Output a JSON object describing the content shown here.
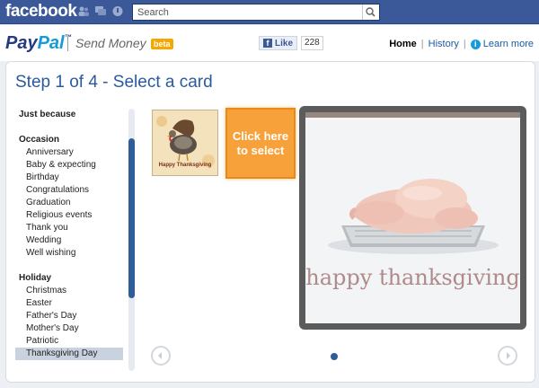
{
  "facebook": {
    "logo": "facebook",
    "search_placeholder": "Search",
    "icons": [
      "friends-icon",
      "messages-icon",
      "notifications-icon"
    ],
    "brand_color": "#3b5998"
  },
  "paypal": {
    "logo_pay": "Pay",
    "logo_pal": "Pal",
    "logo_tm": "™",
    "app_name": "Send Money",
    "beta_badge": "beta",
    "like_label": "Like",
    "like_count": "228",
    "nav": {
      "home": "Home",
      "history": "History",
      "separator": "|",
      "learn_more": "Learn more"
    }
  },
  "step_title": "Step 1 of 4 - Select a card",
  "categories": {
    "just_because": "Just because",
    "occasion_heading": "Occasion",
    "occasion_items": [
      "Anniversary",
      "Baby & expecting",
      "Birthday",
      "Congratulations",
      "Graduation",
      "Religious events",
      "Thank you",
      "Wedding",
      "Well wishing"
    ],
    "holiday_heading": "Holiday",
    "holiday_items": [
      "Christmas",
      "Easter",
      "Father's Day",
      "Mother's Day",
      "Patriotic",
      "Thanksgiving Day"
    ],
    "selected": "Thanksgiving Day"
  },
  "cards": {
    "thumb1_caption": "Happy Thanksgiving",
    "select_prompt_line1": "Click here",
    "select_prompt_line2": "to select",
    "preview_message": "happy thanksgiving"
  },
  "carousel": {
    "prev_icon": "chevron-left-icon",
    "next_icon": "chevron-right-icon",
    "pages": 1,
    "current_page": 1
  },
  "colors": {
    "accent_blue": "#2a5aa0",
    "selected_bg": "#c9d3e0",
    "select_orange": "#f7a13a"
  }
}
